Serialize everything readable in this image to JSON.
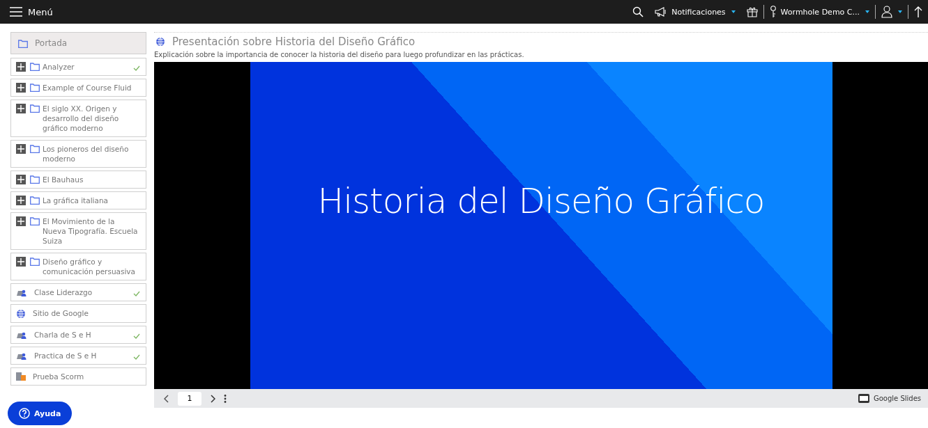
{
  "topbar": {
    "menu_label": "Menú",
    "notifications_label": "Notificaciones",
    "account_label": "Wormhole Demo C..."
  },
  "sidebar": {
    "home": {
      "label": "Portada",
      "selected": true
    },
    "items": [
      {
        "kind": "folder",
        "label": "Analyzer",
        "completed": true
      },
      {
        "kind": "folder",
        "label": "Example of Course Fluid",
        "completed": false
      },
      {
        "kind": "folder",
        "label": "El siglo XX. Origen y desarrollo del diseño gráfico moderno",
        "completed": false
      },
      {
        "kind": "folder",
        "label": "Los pioneros del diseño moderno",
        "completed": false
      },
      {
        "kind": "folder",
        "label": "El Bauhaus",
        "completed": false
      },
      {
        "kind": "folder",
        "label": "La gráfica italiana",
        "completed": false
      },
      {
        "kind": "folder",
        "label": "El Movimiento de la Nueva Tipografía. Escuela Suiza",
        "completed": false
      },
      {
        "kind": "folder",
        "label": "Diseño gráfico y comunicación persuasiva",
        "completed": false
      },
      {
        "kind": "lesson",
        "label": "Clase Liderazgo",
        "completed": true
      },
      {
        "kind": "link",
        "label": "Sitio de Google",
        "completed": false
      },
      {
        "kind": "lesson",
        "label": "Charla de S e H",
        "completed": true
      },
      {
        "kind": "lesson",
        "label": "Practica de S e H",
        "completed": true
      },
      {
        "kind": "scorm",
        "label": "Prueba Scorm",
        "completed": false
      }
    ]
  },
  "content": {
    "title": "Presentación sobre Historia del Diseño Gráfico",
    "description": "Explicación sobre la importancia de conocer la historia del diseño para luego profundizar en las prácticas.",
    "slide": {
      "title": "Historia del Diseño Gráfico",
      "page": "1",
      "provider": "Google Slides"
    }
  },
  "help_button": {
    "label": "Ayuda"
  }
}
